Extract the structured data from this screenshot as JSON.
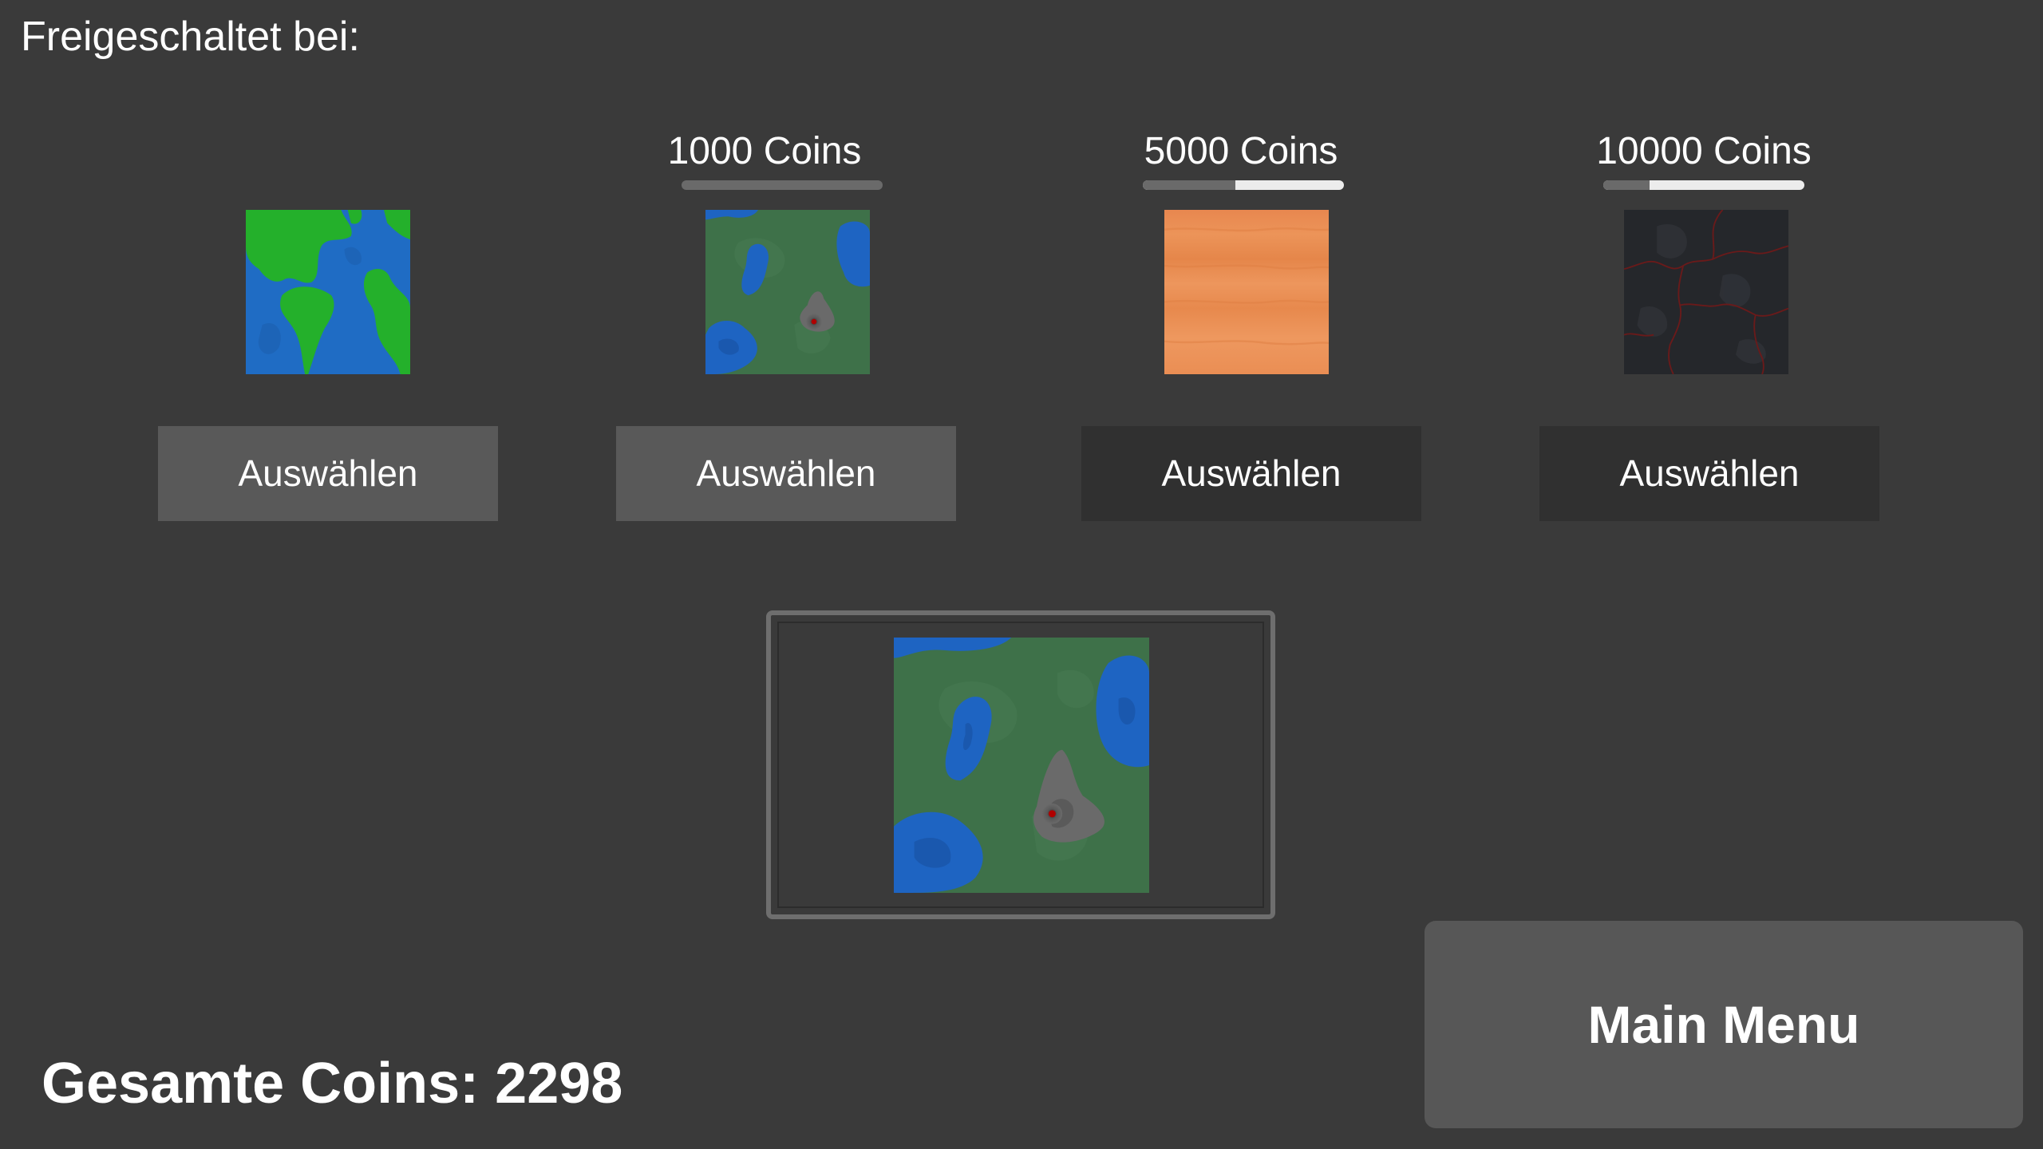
{
  "header": "Freigeschaltet bei:",
  "maps": [
    {
      "price": "",
      "unlock_progress": null,
      "button": "Auswählen",
      "unlocked": true,
      "thumbnail": "earth-map"
    },
    {
      "price": "1000 Coins",
      "unlock_progress": 1.0,
      "button": "Auswählen",
      "unlocked": true,
      "thumbnail": "volcano-island-map"
    },
    {
      "price": "5000 Coins",
      "unlock_progress": 0.46,
      "button": "Auswählen",
      "unlocked": false,
      "thumbnail": "desert-map"
    },
    {
      "price": "10000 Coins",
      "unlock_progress": 0.23,
      "button": "Auswählen",
      "unlocked": false,
      "thumbnail": "lava-rock-map"
    }
  ],
  "preview": {
    "thumbnail": "volcano-island-map"
  },
  "main_menu": "Main Menu",
  "total_coins_text": "Gesamte Coins: 2298",
  "colors": {
    "background": "#3a3a3a",
    "button_unlocked": "#595959",
    "button_locked": "#303030",
    "progress_track": "#ececec",
    "progress_fill": "#6a6a6a"
  }
}
